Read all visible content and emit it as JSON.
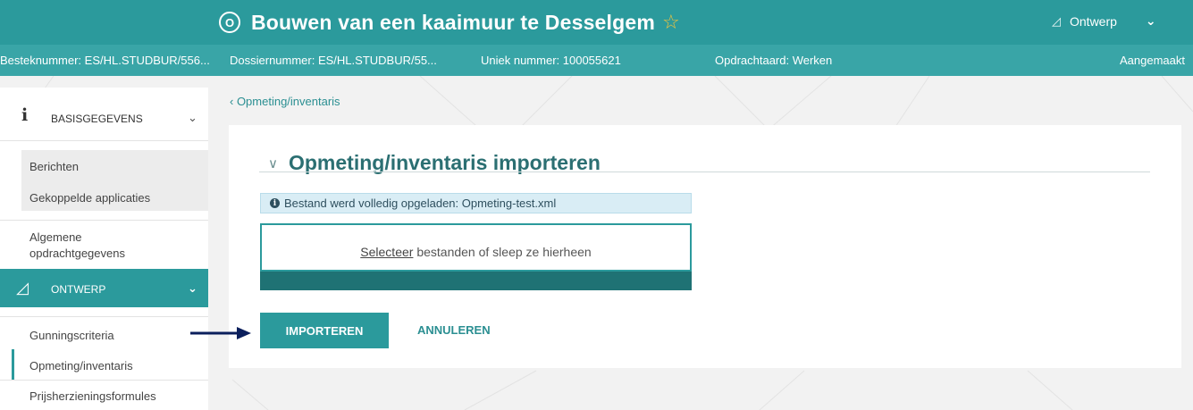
{
  "header": {
    "status_glyph": "O",
    "title": "Bouwen van een kaaimuur te Desselgem",
    "star_icon": "star-outline-icon",
    "phase_icon": "pencil-ruler-icon",
    "phase_label": "Ontwerp",
    "phase_chevron": "chevron-down-icon"
  },
  "subheader": {
    "besteknummer": "Besteknummer: ES/HL.STUDBUR/556...",
    "dossiernummer": "Dossiernummer: ES/HL.STUDBUR/55...",
    "uniek_nummer": "Uniek nummer: 100055621",
    "opdrachtaard": "Opdrachtaard: Werken",
    "status": "Aangemaakt"
  },
  "sidebar": {
    "section1": {
      "icon": "info-icon",
      "label": "BASISGEGEVENS"
    },
    "group_items": [
      "Berichten",
      "Gekoppelde applicaties"
    ],
    "algemene_line1": "Algemene",
    "algemene_line2": "opdrachtgegevens",
    "section2": {
      "icon": "pencil-ruler-icon",
      "label": "ONTWERP"
    },
    "items": [
      "Gunningscriteria",
      "Opmeting/inventaris",
      "Prijsherzieningsformules"
    ],
    "active_item": "Opmeting/inventaris"
  },
  "breadcrumb": "‹ Opmeting/inventaris",
  "main": {
    "section_title": "Opmeting/inventaris importeren",
    "alert_text": "Bestand werd volledig opgeladen: Opmeting-test.xml",
    "dropzone_link": "Selecteer",
    "dropzone_text": " bestanden of sleep ze hierheen",
    "upload_progress": 1.0,
    "import_label": "IMPORTEREN",
    "cancel_label": "ANNULEREN"
  },
  "colors": {
    "brand": "#2b9a9c",
    "brand_dark": "#1f7274",
    "star": "#f3c33c",
    "arrow": "#0b1f5c"
  }
}
